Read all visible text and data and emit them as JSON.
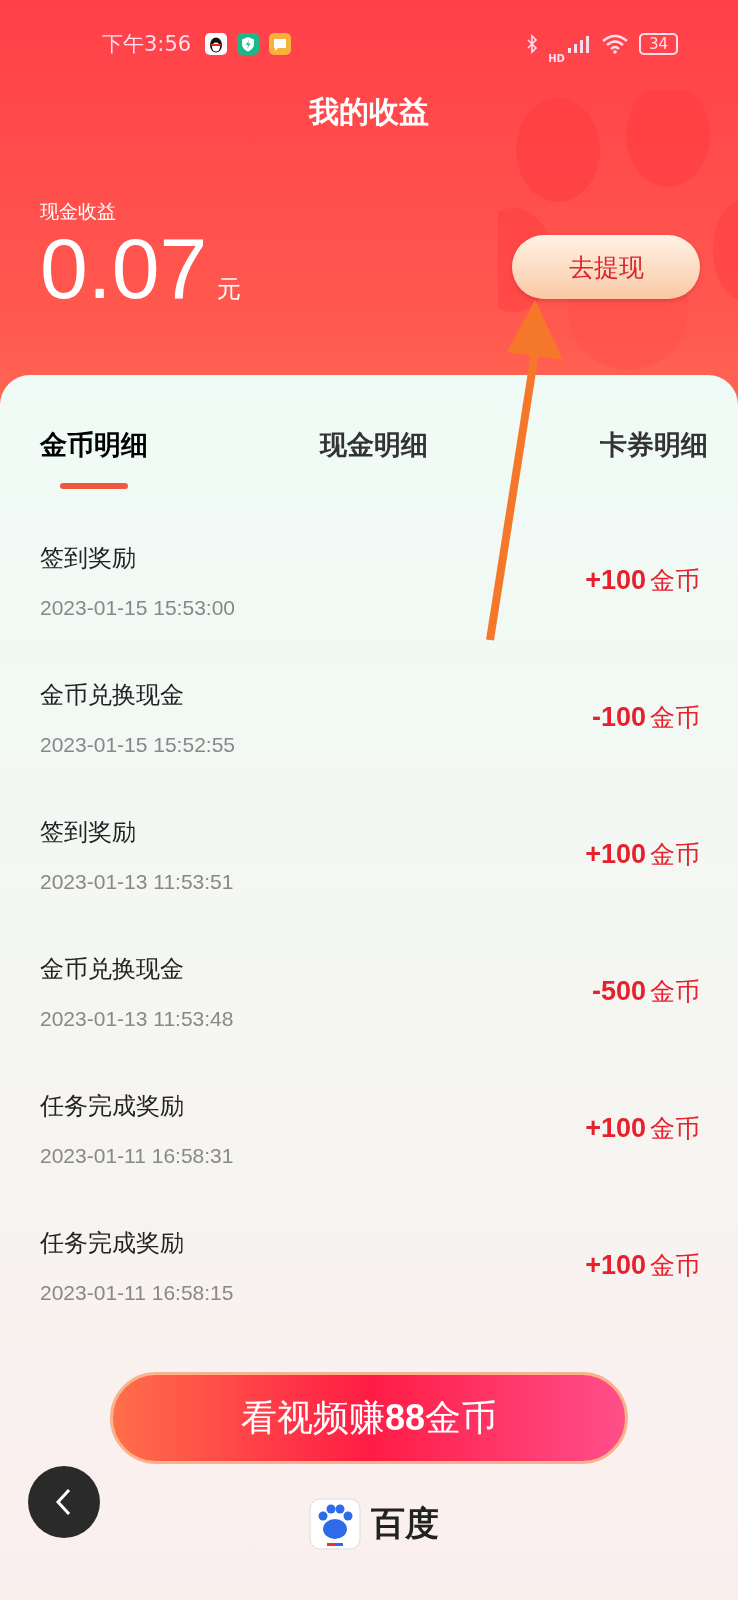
{
  "status_bar": {
    "time": "下午3:56",
    "network": "HD",
    "battery": "34"
  },
  "title": "我的收益",
  "balance": {
    "label": "现金收益",
    "amount": "0.07",
    "unit": "元",
    "button": "去提现"
  },
  "tabs": [
    {
      "label": "金币明细",
      "selected": true
    },
    {
      "label": "现金明细",
      "selected": false
    },
    {
      "label": "卡券明细",
      "selected": false
    }
  ],
  "records": [
    {
      "title": "签到奖励",
      "time": "2023-01-15 15:53:00",
      "amount": "+100",
      "unit": "金币"
    },
    {
      "title": "金币兑换现金",
      "time": "2023-01-15 15:52:55",
      "amount": "-100",
      "unit": "金币"
    },
    {
      "title": "签到奖励",
      "time": "2023-01-13 11:53:51",
      "amount": "+100",
      "unit": "金币"
    },
    {
      "title": "金币兑换现金",
      "time": "2023-01-13 11:53:48",
      "amount": "-500",
      "unit": "金币"
    },
    {
      "title": "任务完成奖励",
      "time": "2023-01-11 16:58:31",
      "amount": "+100",
      "unit": "金币"
    },
    {
      "title": "任务完成奖励",
      "time": "2023-01-11 16:58:15",
      "amount": "+100",
      "unit": "金币"
    }
  ],
  "cta_button": {
    "text": "看视频赚",
    "number": "88",
    "unit": "金币"
  },
  "footer_logo": "百度"
}
